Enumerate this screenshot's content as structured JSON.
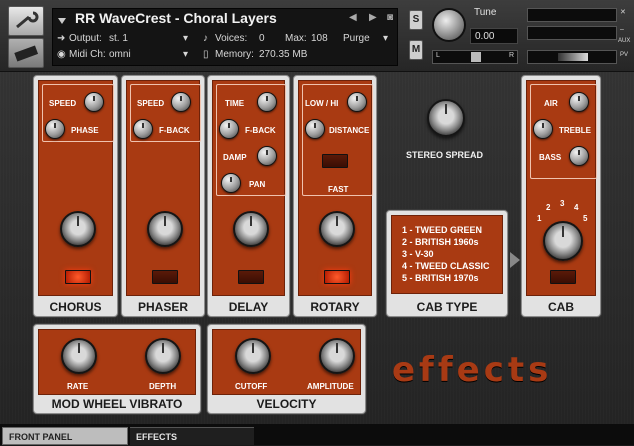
{
  "header": {
    "instrument_name": "RR WaveCrest - Choral Layers",
    "output_label": "Output:",
    "output_value": "st. 1",
    "midi_label": "Midi Ch:",
    "midi_value": "omni",
    "voices_label": "Voices:",
    "voices_value": "0",
    "max_label": "Max:",
    "max_value": "108",
    "purge_label": "Purge",
    "memory_label": "Memory:",
    "memory_value": "270.35 MB",
    "solo_label": "S",
    "mute_label": "M",
    "tune_label": "Tune",
    "tune_value": "0.00",
    "pan_left": "L",
    "pan_right": "R",
    "aux_label": "AUX",
    "pv_label": "PV"
  },
  "modules": {
    "chorus": {
      "label": "CHORUS",
      "speed": "SPEED",
      "phase": "PHASE",
      "led_on": true
    },
    "phaser": {
      "label": "PHASER",
      "speed": "SPEED",
      "fback": "F-BACK",
      "led_on": false
    },
    "delay": {
      "label": "DELAY",
      "time": "TIME",
      "fback": "F-BACK",
      "damp": "DAMP",
      "pan": "PAN",
      "led_on": false
    },
    "rotary": {
      "label": "ROTARY",
      "lowhi": "LOW / HI",
      "distance": "DISTANCE",
      "fast": "FAST",
      "led_on": true
    },
    "stereo_spread": {
      "label": "STEREO SPREAD"
    },
    "cab_type": {
      "label": "CAB TYPE",
      "items": [
        "1 - TWEED GREEN",
        "2 - BRITISH 1960s",
        "3 - V-30",
        "4 - TWEED CLASSIC",
        "5 - BRITISH 1970s"
      ]
    },
    "cab": {
      "label": "CAB",
      "air": "AIR",
      "treble": "TREBLE",
      "bass": "BASS",
      "n1": "1",
      "n2": "2",
      "n3": "3",
      "n4": "4",
      "n5": "5"
    },
    "mod_wheel": {
      "label": "MOD WHEEL VIBRATO",
      "rate": "RATE",
      "depth": "DEPTH"
    },
    "velocity": {
      "label": "VELOCITY",
      "cutoff": "CUTOFF",
      "amplitude": "AMPLITUDE"
    }
  },
  "logo_text": "effects",
  "tabs": {
    "front_panel": "FRONT PANEL",
    "effects": "EFFECTS"
  },
  "colors": {
    "panel_red": "#a93a12",
    "led_on": "#ff3a10",
    "logo": "#a83a14"
  }
}
